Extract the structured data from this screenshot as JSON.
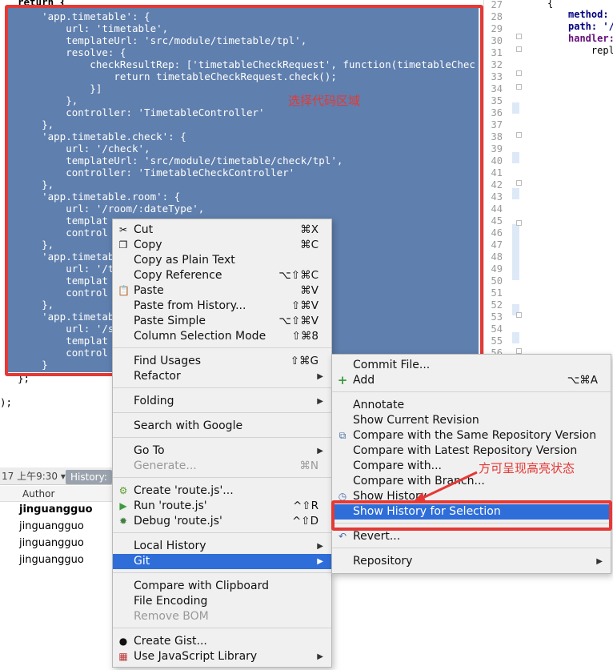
{
  "editor": {
    "top_fragment": "return {",
    "code_lines": [
      "    'app.timetable': {",
      "        url: 'timetable',",
      "        templateUrl: 'src/module/timetable/tpl',",
      "        resolve: {",
      "            checkResultRep: ['timetableCheckRequest', function(timetableCheckReque",
      "                return timetableCheckRequest.check();",
      "            }]",
      "        },",
      "        controller: 'TimetableController'",
      "    },",
      "    'app.timetable.check': {",
      "        url: '/check',",
      "        templateUrl: 'src/module/timetable/check/tpl',",
      "        controller: 'TimetableCheckController'",
      "    },",
      "    'app.timetable.room': {",
      "        url: '/room/:dateType',",
      "        templat",
      "        control",
      "    },",
      "    'app.timetabl",
      "        url: '/to",
      "        templat",
      "        control",
      "    },",
      "    'app.timetabl",
      "        url: '/st",
      "        templat",
      "        control",
      "    }"
    ],
    "after_lines": [
      "};",
      "",
      ");"
    ],
    "line_numbers": [
      "27",
      "28",
      "29",
      "30",
      "31",
      "32",
      "33",
      "34",
      "35",
      "36",
      "37",
      "38",
      "39",
      "40",
      "41",
      "42",
      "43",
      "44",
      "45",
      "46",
      "47",
      "48",
      "49",
      "50",
      "51",
      "52",
      "53",
      "54",
      "55",
      "56"
    ],
    "right_code": [
      "{",
      "method:",
      "path: '/",
      "handler:",
      "    repl"
    ]
  },
  "annotations": {
    "select_region": "选择代码区域",
    "highlight_state": "方可呈现高亮状态"
  },
  "history_panel": {
    "toolbar_text": "17 上午9:30 ▾",
    "tab_label": "History: ro",
    "column_author": "Author",
    "rows": [
      "jinguangguo",
      "jinguangguo",
      "jinguangguo",
      "jinguangguo"
    ]
  },
  "context_menu": {
    "items": [
      {
        "label": "Cut",
        "shortcut": "⌘X",
        "icon": "scissors-icon"
      },
      {
        "label": "Copy",
        "shortcut": "⌘C",
        "icon": "copy-icon"
      },
      {
        "label": "Copy as Plain Text",
        "shortcut": ""
      },
      {
        "label": "Copy Reference",
        "shortcut": "⌥⇧⌘C"
      },
      {
        "label": "Paste",
        "shortcut": "⌘V",
        "icon": "paste-icon"
      },
      {
        "label": "Paste from History...",
        "shortcut": "⇧⌘V"
      },
      {
        "label": "Paste Simple",
        "shortcut": "⌥⇧⌘V"
      },
      {
        "label": "Column Selection Mode",
        "shortcut": "⇧⌘8"
      },
      {
        "label": "Find Usages",
        "shortcut": "⇧⌘G"
      },
      {
        "label": "Refactor",
        "shortcut": ""
      },
      {
        "label": "Folding",
        "shortcut": ""
      },
      {
        "label": "Search with Google",
        "shortcut": ""
      },
      {
        "label": "Go To",
        "shortcut": ""
      },
      {
        "label": "Generate...",
        "shortcut": "⌘N"
      },
      {
        "label": "Create 'route.js'...",
        "shortcut": "",
        "icon": "js-config-icon"
      },
      {
        "label": "Run 'route.js'",
        "shortcut": "^⇧R",
        "icon": "run-icon"
      },
      {
        "label": "Debug 'route.js'",
        "shortcut": "^⇧D",
        "icon": "debug-icon"
      },
      {
        "label": "Local History",
        "shortcut": ""
      },
      {
        "label": "Git",
        "shortcut": ""
      },
      {
        "label": "Compare with Clipboard",
        "shortcut": ""
      },
      {
        "label": "File Encoding",
        "shortcut": ""
      },
      {
        "label": "Remove BOM",
        "shortcut": ""
      },
      {
        "label": "Create Gist...",
        "shortcut": "",
        "icon": "github-icon"
      },
      {
        "label": "Use JavaScript Library",
        "shortcut": "",
        "icon": "library-icon"
      }
    ]
  },
  "git_submenu": {
    "items": [
      {
        "label": "Commit File...",
        "shortcut": ""
      },
      {
        "label": "Add",
        "shortcut": "⌥⌘A",
        "icon": "plus-icon"
      },
      {
        "label": "Annotate",
        "shortcut": ""
      },
      {
        "label": "Show Current Revision",
        "shortcut": ""
      },
      {
        "label": "Compare with the Same Repository Version",
        "shortcut": "",
        "icon": "compare-icon"
      },
      {
        "label": "Compare with Latest Repository Version",
        "shortcut": ""
      },
      {
        "label": "Compare with...",
        "shortcut": ""
      },
      {
        "label": "Compare with Branch...",
        "shortcut": ""
      },
      {
        "label": "Show History",
        "shortcut": "",
        "icon": "history-icon"
      },
      {
        "label": "Show History for Selection",
        "shortcut": ""
      },
      {
        "label": "Revert...",
        "shortcut": "",
        "icon": "revert-icon"
      },
      {
        "label": "Repository",
        "shortcut": ""
      }
    ]
  },
  "colors": {
    "selection": "#5f7fae",
    "highlight": "#2f6ed8",
    "annotation_red": "#e53935"
  }
}
